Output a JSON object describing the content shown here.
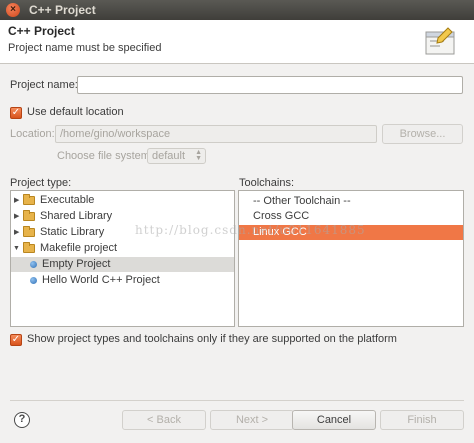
{
  "window": {
    "title": "C++ Project",
    "close_glyph": "×"
  },
  "header": {
    "title": "C++ Project",
    "message": "Project name must be specified",
    "icon": "wizard-banner-icon"
  },
  "project_name": {
    "label": "Project name:",
    "value": ""
  },
  "default_location": {
    "label": "Use default location",
    "checked": true
  },
  "location": {
    "label": "Location:",
    "value": "/home/gino/workspace",
    "browse_label": "Browse..."
  },
  "file_system": {
    "label": "Choose file system:",
    "value": "default"
  },
  "project_type": {
    "label": "Project type:",
    "items": [
      {
        "label": "Executable",
        "expanded": false,
        "kind": "folder"
      },
      {
        "label": "Shared Library",
        "expanded": false,
        "kind": "folder"
      },
      {
        "label": "Static Library",
        "expanded": false,
        "kind": "folder"
      },
      {
        "label": "Makefile project",
        "expanded": true,
        "kind": "folder"
      },
      {
        "label": "Empty Project",
        "kind": "item",
        "selected": true
      },
      {
        "label": "Hello World C++ Project",
        "kind": "item"
      }
    ]
  },
  "toolchains": {
    "label": "Toolchains:",
    "items": [
      {
        "label": "-- Other Toolchain --"
      },
      {
        "label": "Cross GCC"
      },
      {
        "label": "Linux GCC",
        "selected": true
      }
    ]
  },
  "watermark": "http://blog.csdn.net/u011641885",
  "platform_filter": {
    "label": "Show project types and toolchains only if they are supported on the platform",
    "checked": true
  },
  "buttons": {
    "back": "< Back",
    "next": "Next >",
    "cancel": "Cancel",
    "finish": "Finish"
  },
  "help_glyph": "?",
  "colors": {
    "accent": "#f07746",
    "titlebar": "#3f3e3a"
  }
}
